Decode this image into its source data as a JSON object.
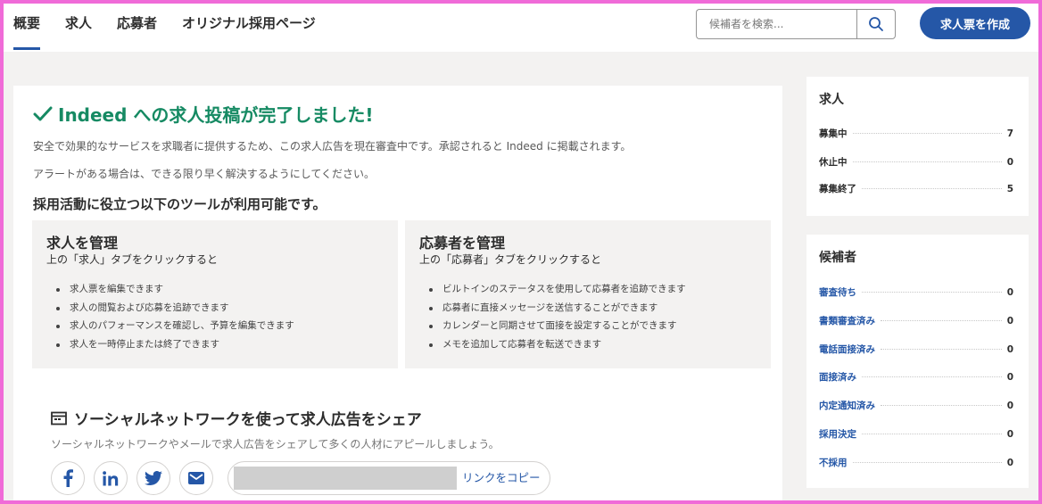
{
  "nav": {
    "tabs": [
      {
        "label": "概要",
        "active": true
      },
      {
        "label": "求人",
        "active": false
      },
      {
        "label": "応募者",
        "active": false
      },
      {
        "label": "オリジナル採用ページ",
        "active": false
      }
    ]
  },
  "search": {
    "placeholder": "候補者を検索...",
    "icon": "search-icon"
  },
  "create_button": {
    "label": "求人票を作成"
  },
  "main": {
    "success_title": "Indeed への求人投稿が完了しました!",
    "desc1": "安全で効果的なサービスを求職者に提供するため、この求人広告を現在審査中です。承認されると Indeed に掲載されます。",
    "desc2": "アラートがある場合は、できる限り早く解決するようにしてください。",
    "tools_title": "採用活動に役立つ以下のツールが利用可能です。",
    "cards": [
      {
        "title": "求人を管理",
        "subtitle": "上の「求人」タブをクリックすると",
        "items": [
          "求人票を編集できます",
          "求人の閲覧および応募を追跡できます",
          "求人のパフォーマンスを確認し、予算を編集できます",
          "求人を一時停止または終了できます"
        ]
      },
      {
        "title": "応募者を管理",
        "subtitle": "上の「応募者」タブをクリックすると",
        "items": [
          "ビルトインのステータスを使用して応募者を追跡できます",
          "応募者に直接メッセージを送信することができます",
          "カレンダーと同期させて面接を設定することができます",
          "メモを追加して応募者を転送できます"
        ]
      }
    ],
    "share_title": "ソーシャルネットワークを使って求人広告をシェア",
    "share_desc": "ソーシャルネットワークやメールで求人広告をシェアして多くの人材にアピールしましょう。",
    "social": [
      "facebook-icon",
      "linkedin-icon",
      "twitter-icon",
      "mail-icon"
    ],
    "copy_link": "リンクをコピー"
  },
  "jobs_card": {
    "title": "求人",
    "rows": [
      {
        "label": "募集中",
        "value": "7"
      },
      {
        "label": "休止中",
        "value": "0"
      },
      {
        "label": "募集終了",
        "value": "5"
      }
    ]
  },
  "candidates_card": {
    "title": "候補者",
    "rows": [
      {
        "label": "審査待ち",
        "value": "0"
      },
      {
        "label": "書類審査済み",
        "value": "0"
      },
      {
        "label": "電話面接済み",
        "value": "0"
      },
      {
        "label": "面接済み",
        "value": "0"
      },
      {
        "label": "内定通知済み",
        "value": "0"
      },
      {
        "label": "採用決定",
        "value": "0"
      },
      {
        "label": "不採用",
        "value": "0"
      }
    ]
  },
  "colors": {
    "brand": "#2557a7",
    "success": "#168a63",
    "frame": "#f06bd8"
  }
}
